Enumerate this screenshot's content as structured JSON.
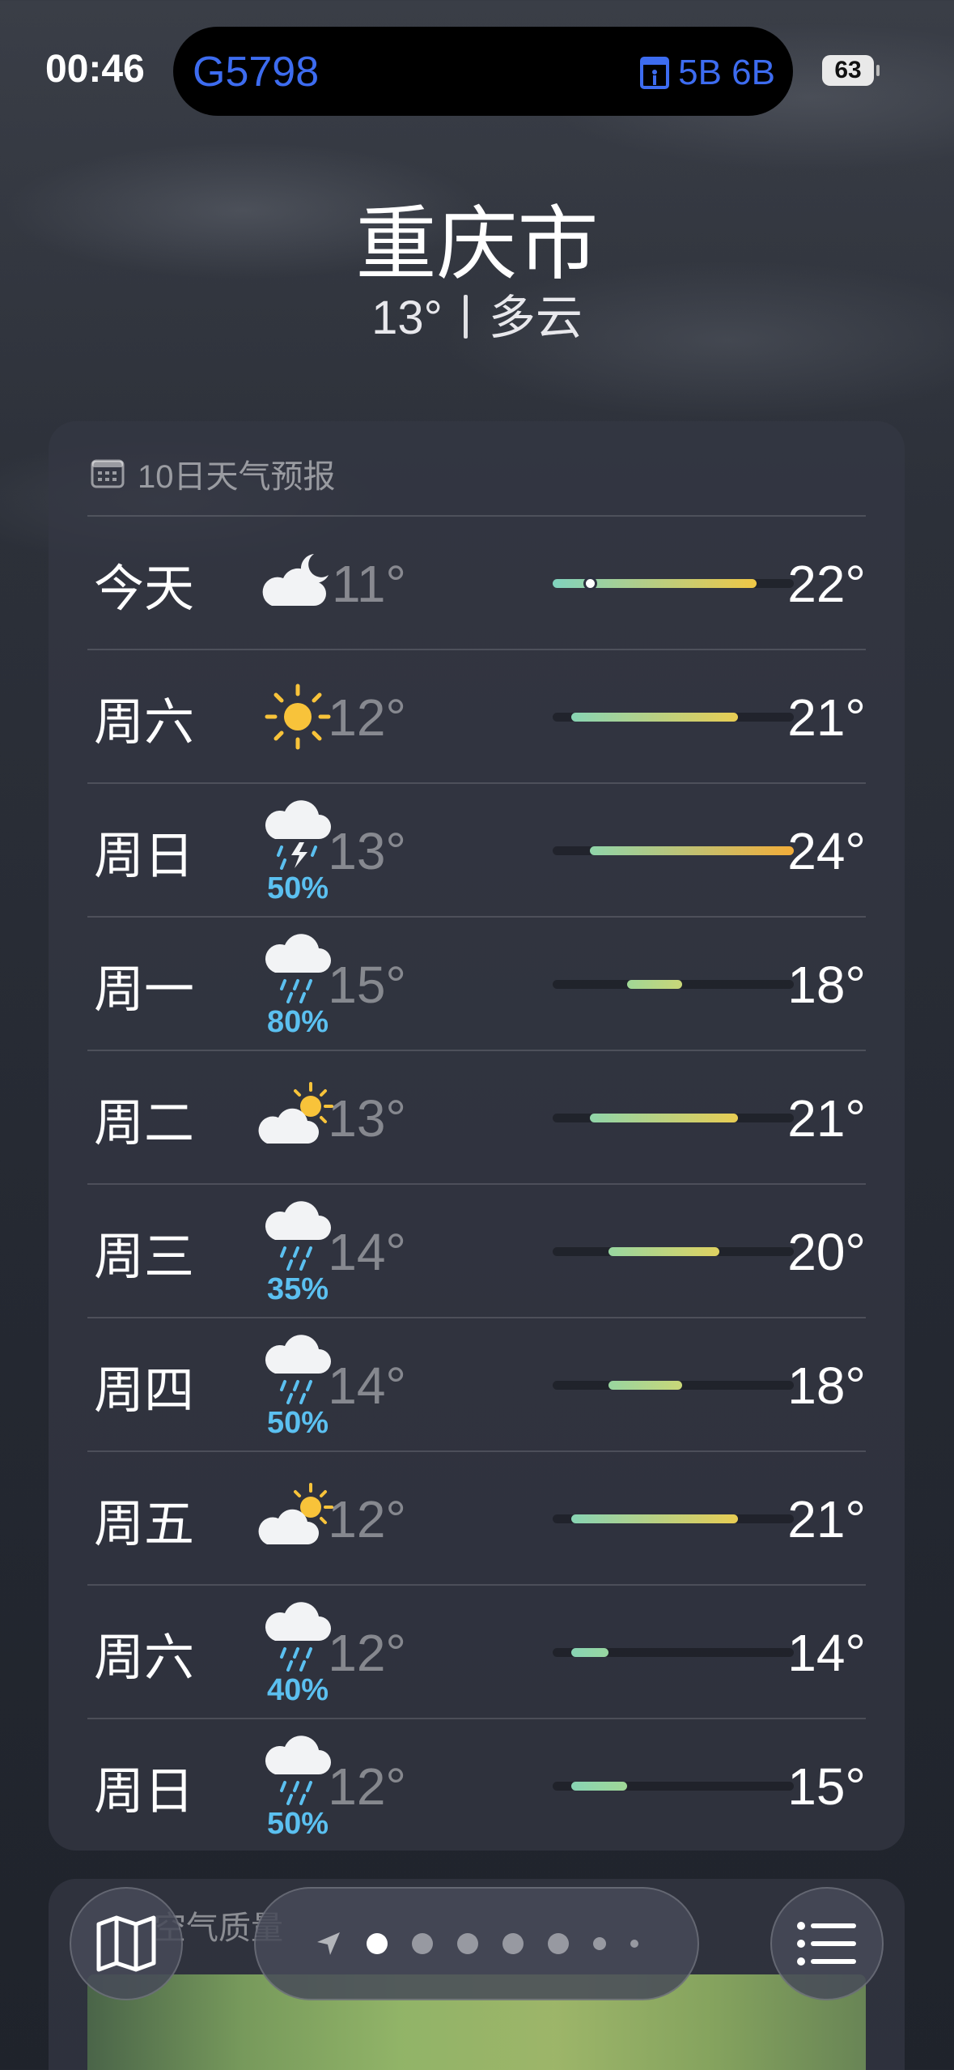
{
  "status_bar": {
    "time": "00:46",
    "train": "G5798",
    "gate": "5B 6B",
    "battery": "63"
  },
  "header": {
    "city": "重庆市",
    "temperature": "13°",
    "condition": "多云"
  },
  "forecast": {
    "title": "10日天气预报",
    "range_min": 11,
    "range_max": 24,
    "current_temp": 13,
    "days": [
      {
        "day": "今天",
        "icon": "partly-cloudy-night-icon",
        "precip": "",
        "low": "11°",
        "high": "22°",
        "low_val": 11,
        "high_val": 22
      },
      {
        "day": "周六",
        "icon": "sun-icon",
        "precip": "",
        "low": "12°",
        "high": "21°",
        "low_val": 12,
        "high_val": 21
      },
      {
        "day": "周日",
        "icon": "thunderstorm-icon",
        "precip": "50%",
        "low": "13°",
        "high": "24°",
        "low_val": 13,
        "high_val": 24
      },
      {
        "day": "周一",
        "icon": "rain-icon",
        "precip": "80%",
        "low": "15°",
        "high": "18°",
        "low_val": 15,
        "high_val": 18
      },
      {
        "day": "周二",
        "icon": "partly-sunny-icon",
        "precip": "",
        "low": "13°",
        "high": "21°",
        "low_val": 13,
        "high_val": 21
      },
      {
        "day": "周三",
        "icon": "rain-icon",
        "precip": "35%",
        "low": "14°",
        "high": "20°",
        "low_val": 14,
        "high_val": 20
      },
      {
        "day": "周四",
        "icon": "rain-icon",
        "precip": "50%",
        "low": "14°",
        "high": "18°",
        "low_val": 14,
        "high_val": 18
      },
      {
        "day": "周五",
        "icon": "partly-sunny-icon",
        "precip": "",
        "low": "12°",
        "high": "21°",
        "low_val": 12,
        "high_val": 21
      },
      {
        "day": "周六",
        "icon": "rain-icon",
        "precip": "40%",
        "low": "12°",
        "high": "14°",
        "low_val": 12,
        "high_val": 14
      },
      {
        "day": "周日",
        "icon": "rain-icon",
        "precip": "50%",
        "low": "12°",
        "high": "15°",
        "low_val": 12,
        "high_val": 15
      }
    ]
  },
  "air_quality": {
    "title": "空气质量"
  },
  "toolbar": {
    "map_icon": "map-icon",
    "list_icon": "list-icon",
    "page_count": 7,
    "active_page": 1
  },
  "colors": {
    "precip": "#5bc0f0",
    "train_text": "#3d6cf0"
  }
}
